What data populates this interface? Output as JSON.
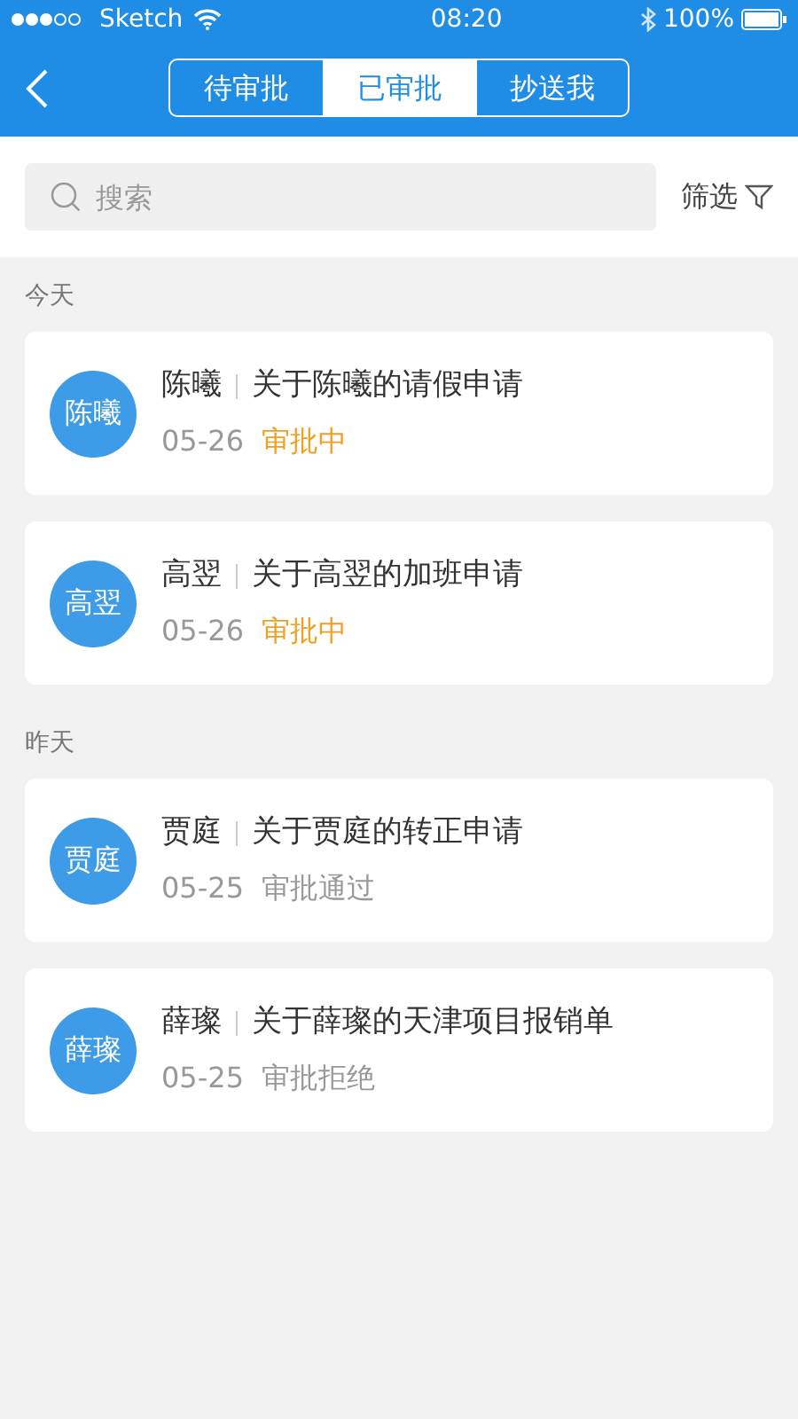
{
  "status_bar": {
    "carrier": "Sketch",
    "time": "08:20",
    "battery": "100%"
  },
  "tabs": [
    {
      "label": "待审批",
      "selected": false
    },
    {
      "label": "已审批",
      "selected": true
    },
    {
      "label": "抄送我",
      "selected": false
    }
  ],
  "search": {
    "placeholder": "搜索"
  },
  "filter": {
    "label": "筛选"
  },
  "sections": [
    {
      "title": "今天",
      "items": [
        {
          "avatar": "陈曦",
          "name": "陈曦",
          "title": "关于陈曦的请假申请",
          "date": "05-26",
          "status": "审批中",
          "kind": "pending"
        },
        {
          "avatar": "高翌",
          "name": "高翌",
          "title": "关于高翌的加班申请",
          "date": "05-26",
          "status": "审批中",
          "kind": "pending"
        }
      ]
    },
    {
      "title": "昨天",
      "items": [
        {
          "avatar": "贾庭",
          "name": "贾庭",
          "title": "关于贾庭的转正申请",
          "date": "05-25",
          "status": "审批通过",
          "kind": "approved"
        },
        {
          "avatar": "薛璨",
          "name": "薛璨",
          "title": "关于薛璨的天津项目报销单",
          "date": "05-25",
          "status": "审批拒绝",
          "kind": "rejected"
        }
      ]
    }
  ]
}
